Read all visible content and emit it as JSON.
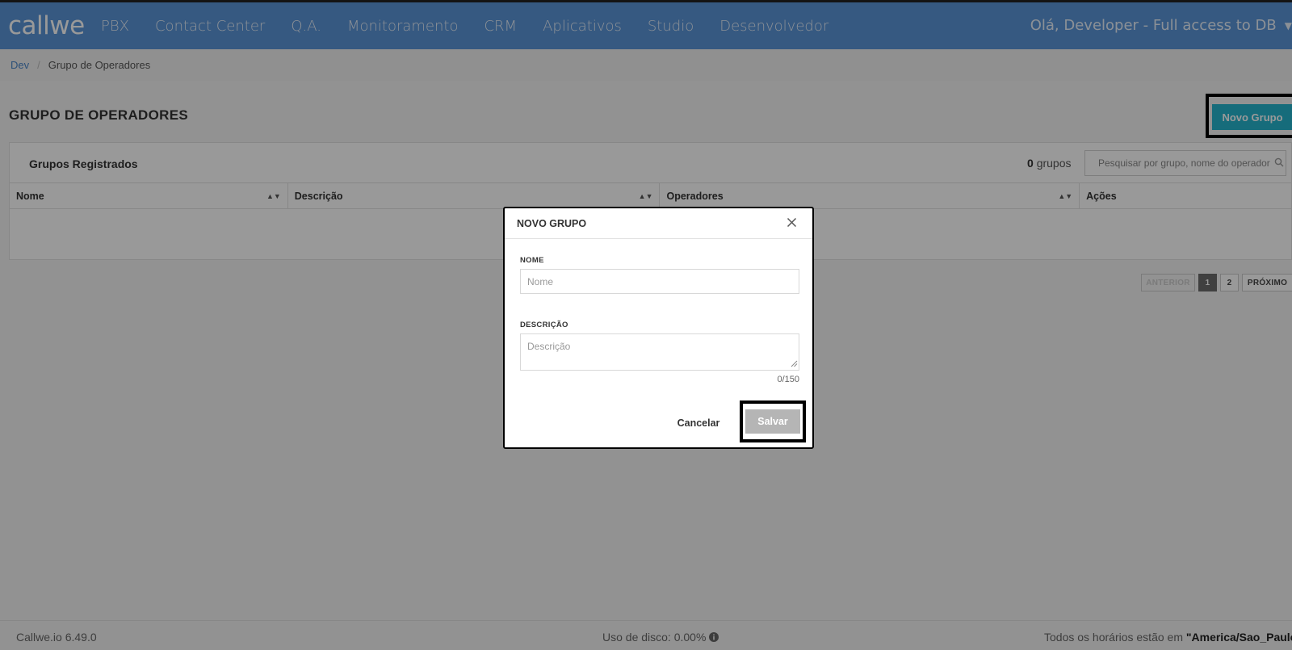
{
  "app": {
    "logo_text": "callwe"
  },
  "nav": {
    "items": [
      "PBX",
      "Contact Center",
      "Q.A.",
      "Monitoramento",
      "CRM",
      "Aplicativos",
      "Studio",
      "Desenvolvedor"
    ],
    "user_greeting": "Olá, Developer - Full access to DB"
  },
  "breadcrumb": {
    "root": "Dev",
    "current": "Grupo de Operadores"
  },
  "page": {
    "title": "GRUPO DE OPERADORES",
    "new_button": "Novo Grupo"
  },
  "panel": {
    "title": "Grupos Registrados",
    "count_number": "0",
    "count_label": "grupos",
    "search_placeholder": "Pesquisar por grupo, nome do operador"
  },
  "table": {
    "columns": [
      "Nome",
      "Descrição",
      "Operadores",
      "Ações"
    ]
  },
  "pagination": {
    "prev": "ANTERIOR",
    "pages": [
      "1",
      "2"
    ],
    "next": "PRÓXIMO",
    "active_page": "1"
  },
  "footer": {
    "version": "Callwe.io 6.49.0",
    "disk_usage": "Uso de disco: 0.00%",
    "timezone_prefix": "Todos os horários estão em",
    "timezone": "\"America/Sao_Paulo\""
  },
  "modal": {
    "title": "NOVO GRUPO",
    "name_label": "NOME",
    "name_placeholder": "Nome",
    "description_label": "DESCRIÇÃO",
    "description_placeholder": "Descrição",
    "counter": "0/150",
    "cancel": "Cancelar",
    "save": "Salvar"
  },
  "colors": {
    "header_blue": "#5a95d8",
    "accent_teal": "#25b4cd",
    "save_disabled": "#b5b5b5"
  }
}
